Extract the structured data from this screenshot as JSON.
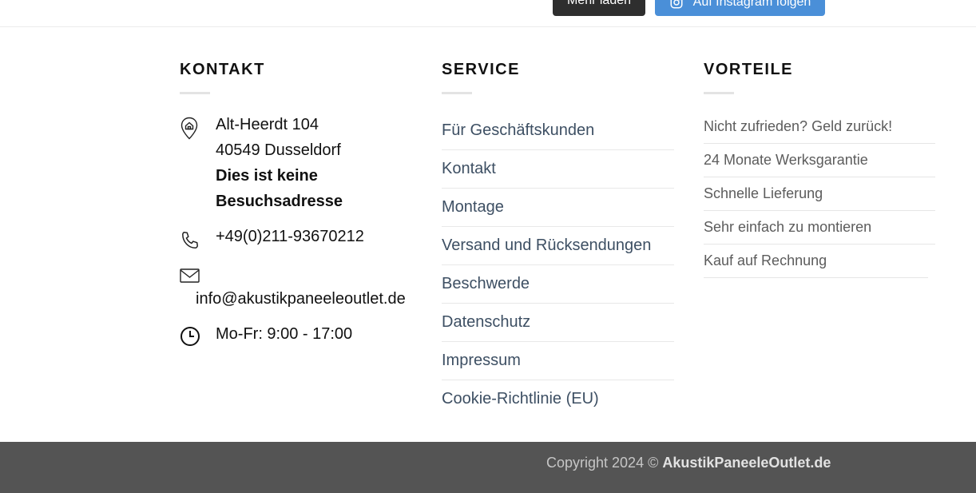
{
  "top": {
    "more_button": "Mehr laden",
    "instagram_button": "Auf Instagram folgen"
  },
  "kontakt": {
    "heading": "KONTAKT",
    "address_line1": "Alt-Heerdt 104",
    "address_line2": "40549 Dusseldorf",
    "address_note1": "Dies ist keine",
    "address_note2": "Besuchsadresse",
    "phone": "+49(0)211-93670212",
    "email": "info@akustikpaneeleoutlet.de",
    "hours": "Mo-Fr: 9:00 - 17:00"
  },
  "service": {
    "heading": "SERVICE",
    "items": [
      "Für Geschäftskunden",
      "Kontakt",
      "Montage",
      "Versand und Rücksendungen",
      "Beschwerde",
      "Datenschutz",
      "Impressum",
      "Cookie-Richtlinie (EU)"
    ]
  },
  "vorteile": {
    "heading": "VORTEILE",
    "items": [
      "Nicht zufrieden? Geld zurück!",
      "24 Monate Werksgarantie",
      "Schnelle Lieferung",
      "Sehr einfach zu montieren",
      "Kauf auf Rechnung"
    ]
  },
  "footer": {
    "copyright_prefix": "Copyright 2024 © ",
    "brand": "AkustikPaneeleOutlet.de"
  },
  "icons": {
    "location": "location-pin-icon",
    "phone": "phone-icon",
    "email": "envelope-icon",
    "clock": "clock-icon",
    "instagram": "instagram-icon"
  },
  "colors": {
    "link": "#3d4f63",
    "instagram_button": "#4a8fd8",
    "footer_bg": "#545454"
  }
}
